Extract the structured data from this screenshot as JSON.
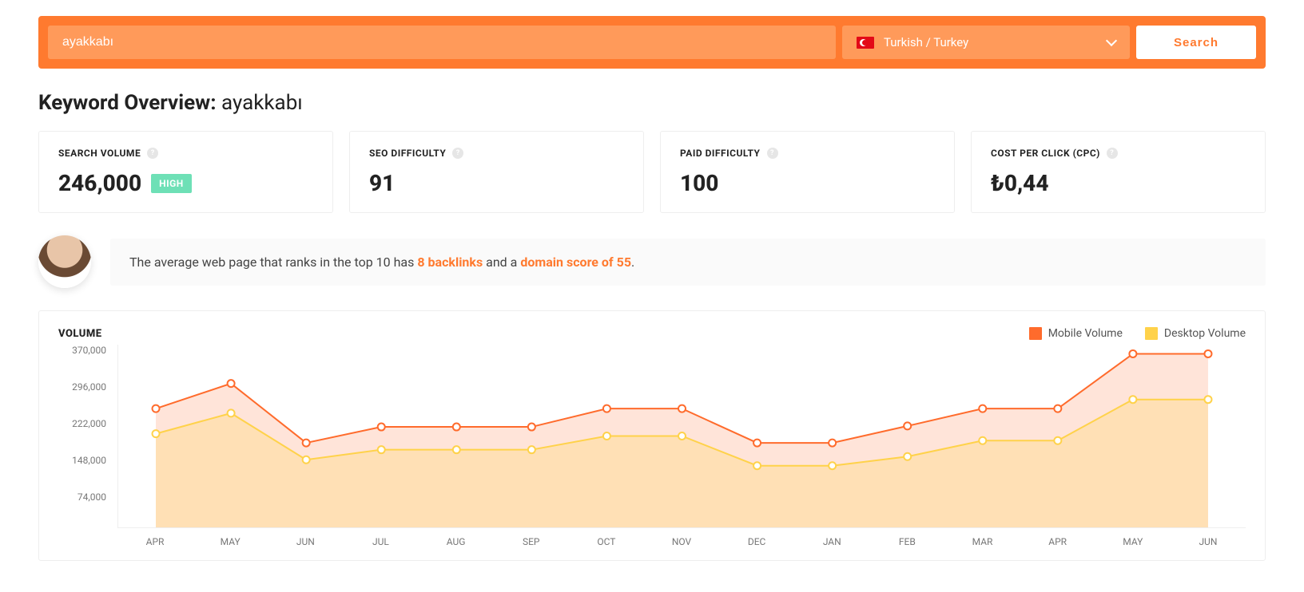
{
  "search": {
    "value": "ayakkabı",
    "language_label": "Turkish / Turkey",
    "button_label": "Search"
  },
  "overview": {
    "title_prefix": "Keyword Overview: ",
    "keyword": "ayakkabı"
  },
  "metrics": {
    "search_volume": {
      "label": "SEARCH VOLUME",
      "value": "246,000",
      "badge": "HIGH"
    },
    "seo_difficulty": {
      "label": "SEO DIFFICULTY",
      "value": "91"
    },
    "paid_difficulty": {
      "label": "PAID DIFFICULTY",
      "value": "100"
    },
    "cpc": {
      "label": "COST PER CLICK (CPC)",
      "value": "₺0,44"
    }
  },
  "insight": {
    "pre": "The average web page that ranks in the top 10 has ",
    "backlinks": "8 backlinks",
    "mid": " and a ",
    "domain_score": "domain score of 55",
    "post": "."
  },
  "chart": {
    "title": "VOLUME",
    "legend": {
      "mobile": "Mobile Volume",
      "desktop": "Desktop Volume"
    },
    "colors": {
      "mobile": "#ff6b2c",
      "desktop": "#ffd24a"
    }
  },
  "chart_data": {
    "type": "line",
    "xlabel": "",
    "ylabel": "",
    "ylim": [
      0,
      400000
    ],
    "y_ticks": [
      "370,000",
      "296,000",
      "222,000",
      "148,000",
      "74,000"
    ],
    "categories": [
      "APR",
      "MAY",
      "JUN",
      "JUL",
      "AUG",
      "SEP",
      "OCT",
      "NOV",
      "DEC",
      "JAN",
      "FEB",
      "MAR",
      "APR",
      "MAY",
      "JUN"
    ],
    "series": [
      {
        "name": "Mobile Volume",
        "color": "#ff6b2c",
        "values": [
          260000,
          315000,
          185000,
          220000,
          220000,
          220000,
          260000,
          260000,
          185000,
          185000,
          222000,
          260000,
          260000,
          380000,
          380000
        ]
      },
      {
        "name": "Desktop Volume",
        "color": "#ffd24a",
        "values": [
          205000,
          250000,
          148000,
          170000,
          170000,
          170000,
          200000,
          200000,
          135000,
          135000,
          155000,
          190000,
          190000,
          280000,
          280000
        ]
      }
    ]
  }
}
